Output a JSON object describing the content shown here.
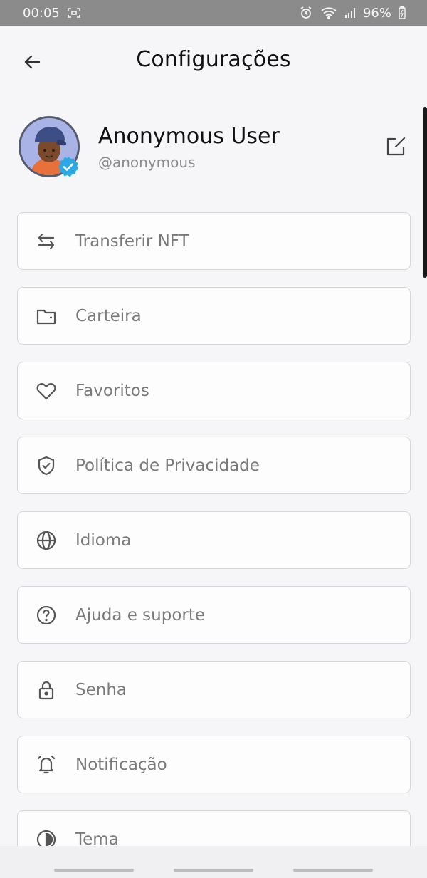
{
  "status_bar": {
    "time": "00:05",
    "battery": "96%"
  },
  "header": {
    "title": "Configurações"
  },
  "profile": {
    "name": "Anonymous User",
    "handle": "@anonymous"
  },
  "menu": {
    "items": [
      {
        "label": "Transferir NFT",
        "icon": "transfer-icon"
      },
      {
        "label": "Carteira",
        "icon": "wallet-icon"
      },
      {
        "label": "Favoritos",
        "icon": "heart-icon"
      },
      {
        "label": "Política de Privacidade",
        "icon": "shield-check-icon"
      },
      {
        "label": "Idioma",
        "icon": "globe-icon"
      },
      {
        "label": "Ajuda e suporte",
        "icon": "help-circle-icon"
      },
      {
        "label": "Senha",
        "icon": "lock-icon"
      },
      {
        "label": "Notificação",
        "icon": "bell-icon"
      },
      {
        "label": "Tema",
        "icon": "theme-icon"
      }
    ]
  },
  "colors": {
    "background": "#f6f6f8",
    "status_bar": "#8b8b8b",
    "card_border": "#d6d6d8",
    "label_text": "#7a7a7a",
    "verified_badge": "#2ba9e6"
  }
}
